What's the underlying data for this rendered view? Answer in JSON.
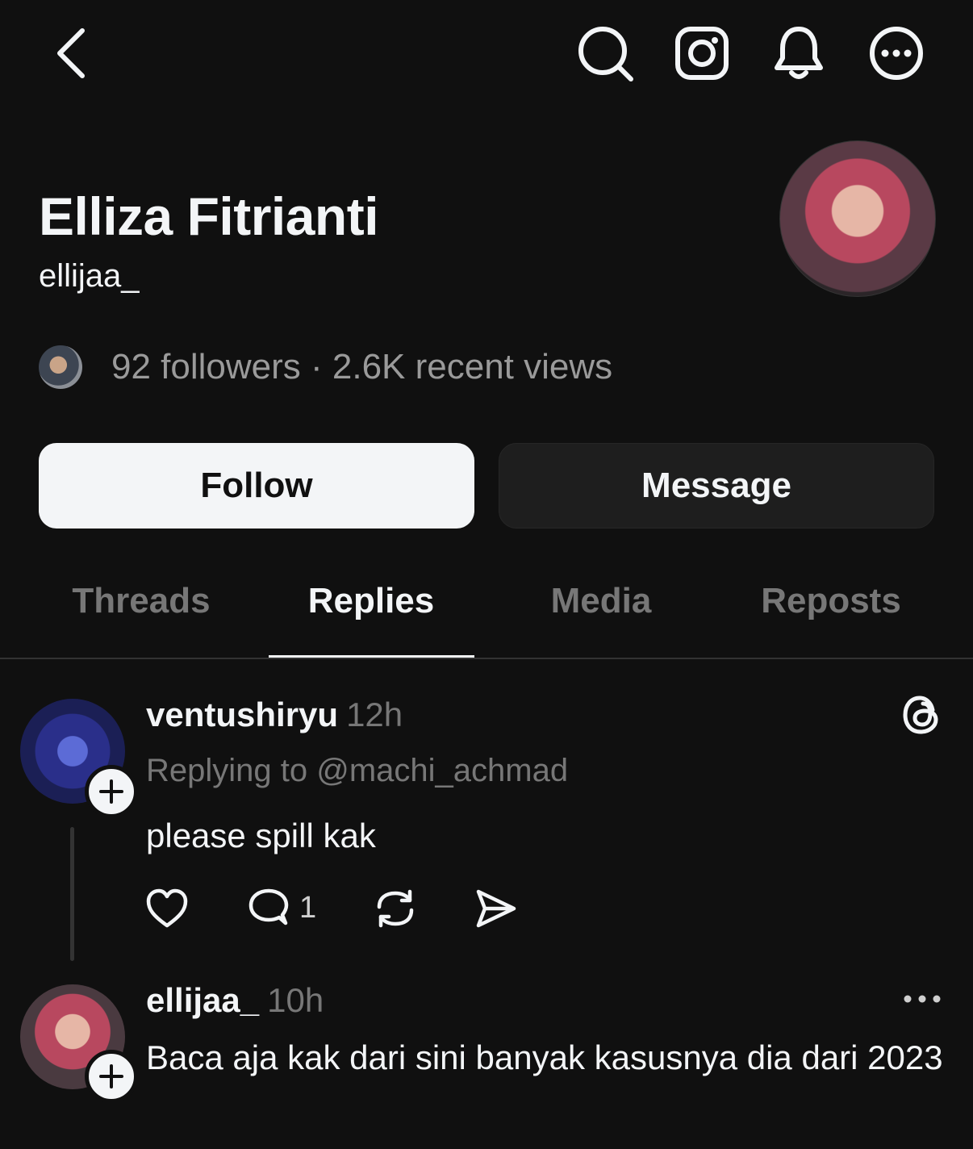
{
  "header": {
    "icons": [
      "back-icon",
      "search-icon",
      "instagram-icon",
      "bell-icon",
      "more-icon"
    ]
  },
  "profile": {
    "display_name": "Elliza Fitrianti",
    "username": "ellijaa_",
    "followers_line": "92 followers · 2.6K recent views"
  },
  "buttons": {
    "follow": "Follow",
    "message": "Message"
  },
  "tabs": [
    {
      "label": "Threads",
      "active": false
    },
    {
      "label": "Replies",
      "active": true
    },
    {
      "label": "Media",
      "active": false
    },
    {
      "label": "Reposts",
      "active": false
    }
  ],
  "posts": [
    {
      "author": "ventushiryu",
      "time": "12h",
      "replying_to": "Replying to @machi_achmad",
      "text": "please spill kak",
      "reply_count": "1"
    },
    {
      "author": "ellijaa_",
      "time": "10h",
      "text": "Baca aja kak dari sini banyak kasusnya dia dari 2023"
    }
  ],
  "colors": {
    "background": "#101010",
    "text_primary": "#f3f5f7",
    "text_secondary": "#777777",
    "follow_button_bg": "#f3f5f7",
    "message_button_bg": "#1e1e1e"
  }
}
